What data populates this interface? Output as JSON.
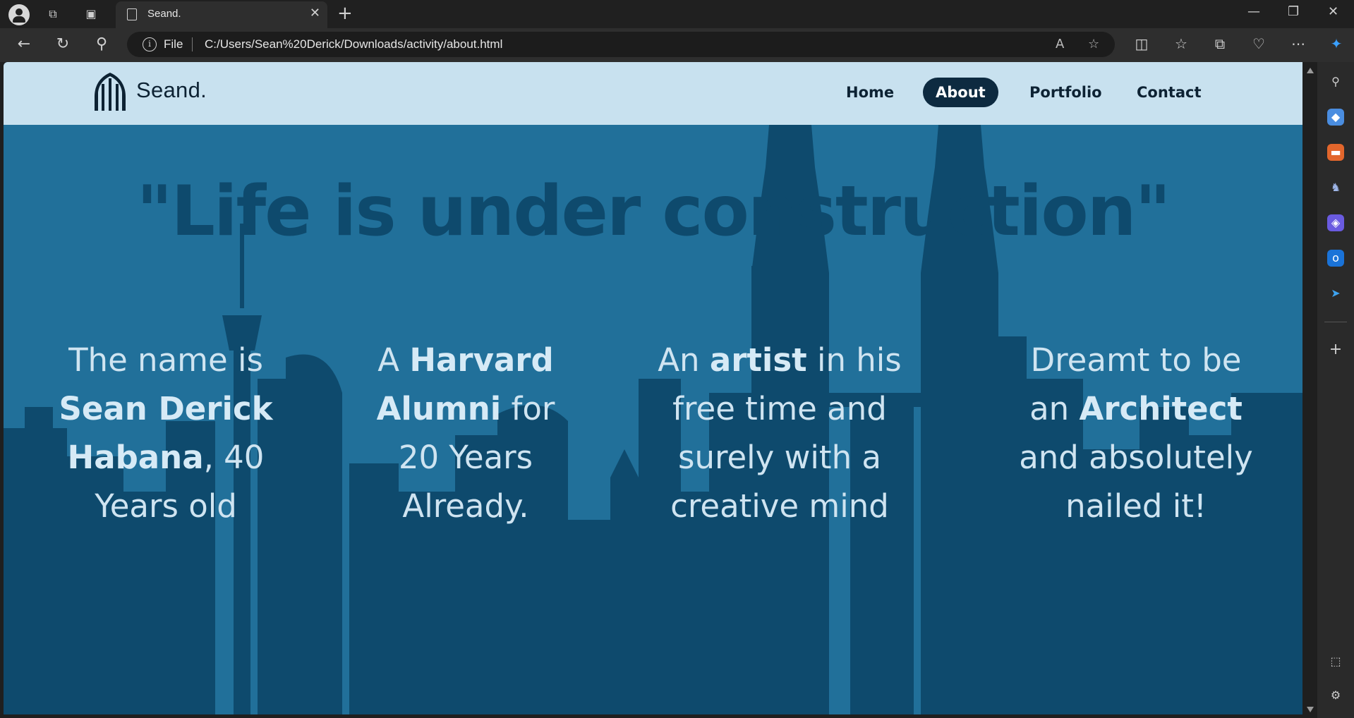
{
  "browser": {
    "tab_title": "Seand.",
    "url_scheme_label": "File",
    "url": "C:/Users/Sean%20Derick/Downloads/activity/about.html"
  },
  "site": {
    "logo_text": "Seand.",
    "nav": [
      {
        "label": "Home",
        "active": false
      },
      {
        "label": "About",
        "active": true
      },
      {
        "label": "Portfolio",
        "active": false
      },
      {
        "label": "Contact",
        "active": false
      }
    ],
    "quote": "\"Life is under construction\"",
    "columns": [
      {
        "line1_pre": "The name is",
        "line2_bold": "Sean Derick",
        "line3_bold": "Habana",
        "line3_rest": ", 40",
        "line4": "Years old"
      },
      {
        "line1_pre": "A ",
        "line1_bold": "Harvard",
        "line2_bold": "Alumni",
        "line2_rest": " for",
        "line3": "20 Years",
        "line4": "Already."
      },
      {
        "line1_pre": "An ",
        "line1_bold": "artist",
        "line1_rest": " in his",
        "line2": "free time and",
        "line3": "surely with a",
        "line4": "creative mind"
      },
      {
        "line1": "Dreamt to be",
        "line2_pre": "an ",
        "line2_bold": "Architect",
        "line3": "and absolutely",
        "line4": "nailed it!"
      }
    ]
  },
  "colors": {
    "header_bg": "#c8e1ef",
    "hero_bg": "#21709a",
    "skyline": "#0e4a6d",
    "nav_active": "#0d2a40"
  }
}
